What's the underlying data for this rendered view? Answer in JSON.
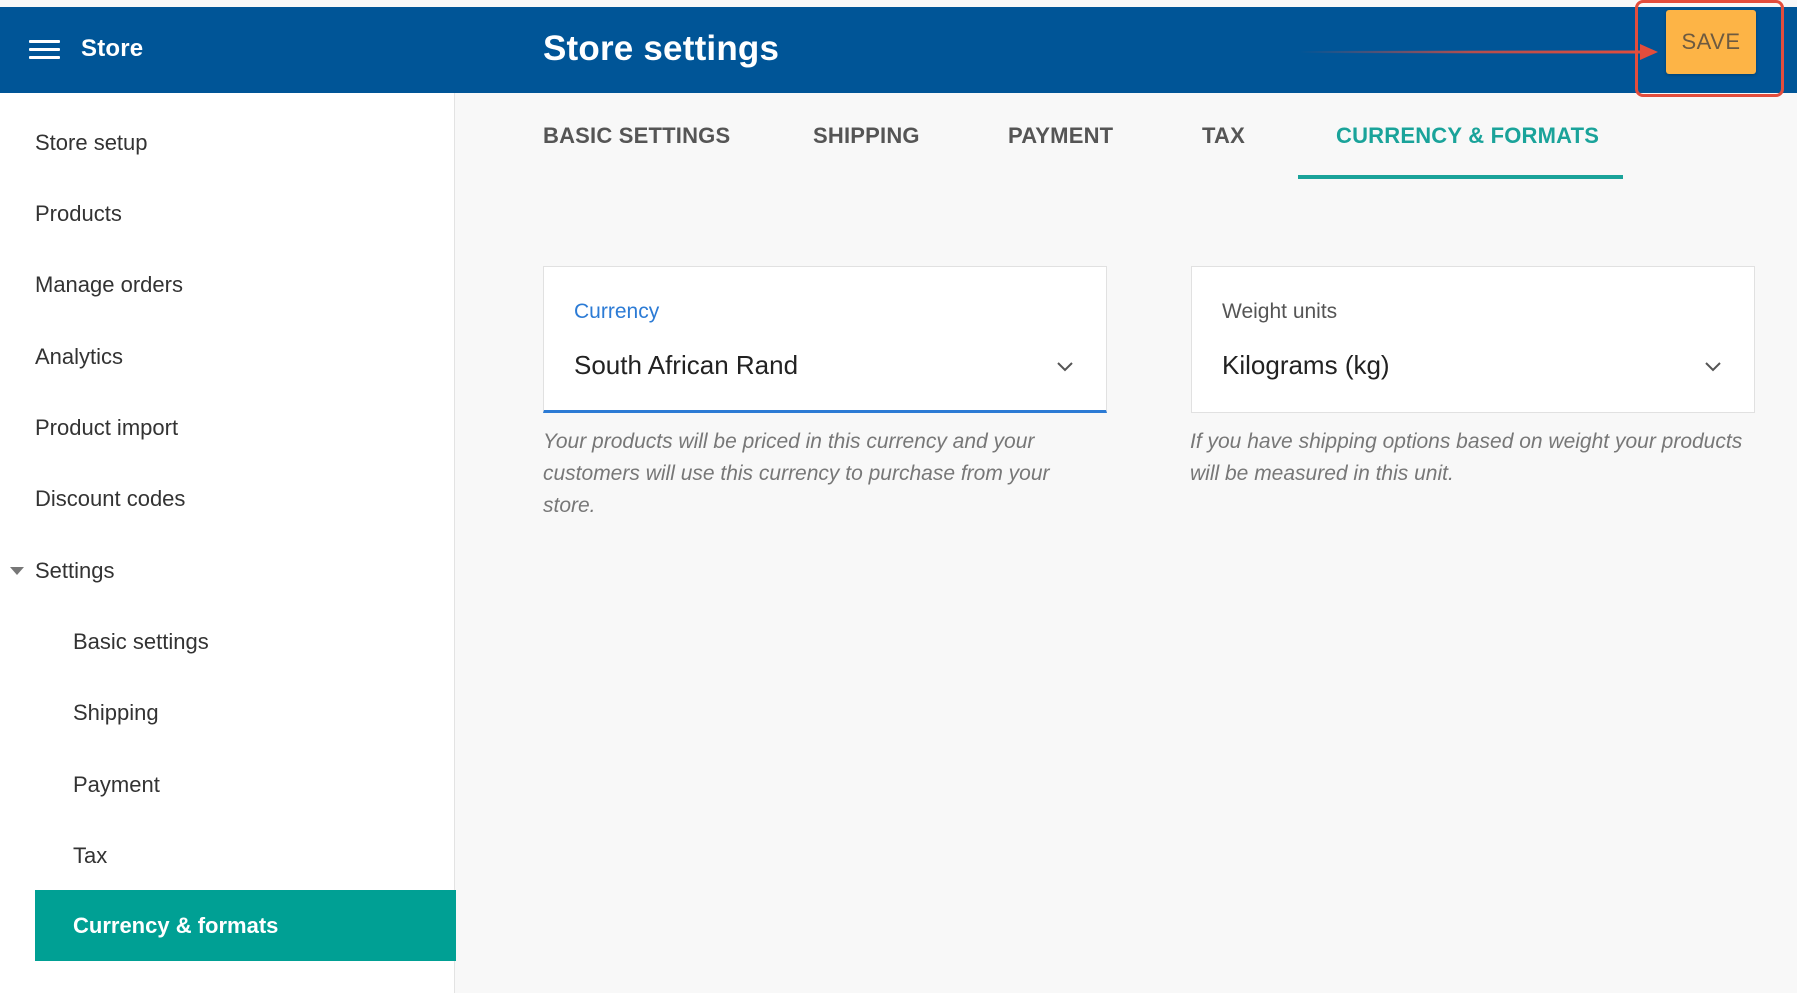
{
  "header": {
    "app_title": "Store",
    "page_title": "Store settings",
    "save_label": "SAVE"
  },
  "sidebar": {
    "items": [
      {
        "label": "Store setup"
      },
      {
        "label": "Products"
      },
      {
        "label": "Manage orders"
      },
      {
        "label": "Analytics"
      },
      {
        "label": "Product import"
      },
      {
        "label": "Discount codes"
      },
      {
        "label": "Settings"
      }
    ],
    "sub_items": [
      {
        "label": "Basic settings"
      },
      {
        "label": "Shipping"
      },
      {
        "label": "Payment"
      },
      {
        "label": "Tax"
      },
      {
        "label": "Currency & formats"
      }
    ]
  },
  "tabs": [
    {
      "label": "BASIC SETTINGS"
    },
    {
      "label": "SHIPPING"
    },
    {
      "label": "PAYMENT"
    },
    {
      "label": "TAX"
    },
    {
      "label": "CURRENCY & FORMATS"
    }
  ],
  "currency": {
    "label": "Currency",
    "value": "South African Rand",
    "help": "Your products will be priced in this currency and your customers will use this currency to purchase from your store."
  },
  "weight": {
    "label": "Weight units",
    "value": "Kilograms (kg)",
    "help": "If you have shipping options based on weight your products will be measured in this unit."
  },
  "colors": {
    "header_bg": "#005597",
    "accent_teal": "#00a094",
    "save_button": "#fdb446",
    "focus_blue": "#2c7bd5",
    "annotation_red": "#e34d3c"
  }
}
